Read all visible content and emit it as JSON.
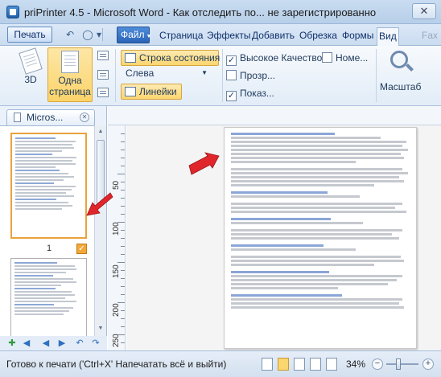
{
  "window": {
    "title": "priPrinter 4.5 - Microsoft Word - Как отследить по... не зарегистрированно",
    "close_glyph": "✕"
  },
  "menubar": {
    "print_button": "Печать",
    "file_tab": "Файл",
    "tabs": [
      "Страница",
      "Эффекты",
      "Добавить",
      "Обрезка",
      "Формы",
      "Вид",
      "Fax"
    ],
    "active_tab": "Вид"
  },
  "ribbon": {
    "view_3d": "3D",
    "one_page_line1": "Одна",
    "one_page_line2": "страница",
    "status_bar_toggle": "Строка состояния",
    "align_select": "Слева",
    "rulers_toggle": "Линейки",
    "high_quality": "Высокое Качество",
    "transparent": "Прозр...",
    "show": "Показ...",
    "numbers": "Номе...",
    "scale": "Масштаб",
    "high_quality_checked": true,
    "transparent_checked": false,
    "show_checked": true,
    "numbers_checked": false
  },
  "thumbnails": {
    "tab_label": "Micros...",
    "page_number": "1",
    "page_checked": true
  },
  "ruler": {
    "labels": [
      "50",
      "100",
      "150",
      "200",
      "250"
    ]
  },
  "status": {
    "text": "Готово к печати ('Ctrl+X' Напечатать всё и выйти)",
    "zoom": "34%"
  },
  "colors": {
    "accent_orange": "#fbd56e",
    "arrow_red": "#e0262b",
    "link_blue": "#2a64b6"
  }
}
